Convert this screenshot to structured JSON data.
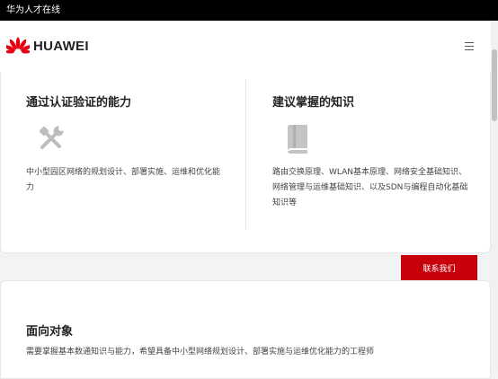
{
  "window": {
    "title": "华为人才在线"
  },
  "header": {
    "logo_text": "HUAWEI",
    "menu_icon": "hamburger-menu-icon",
    "brand_color": "#c7000b"
  },
  "capability": {
    "title": "通过认证验证的能力",
    "icon": "tools-icon",
    "description": "中小型园区网络的规划设计、部署实施、运维和优化能力"
  },
  "knowledge": {
    "title": "建议掌握的知识",
    "icon": "book-icon",
    "description": "路由交换原理、WLAN基本原理、网络安全基础知识、网络管理与运维基础知识、以及SDN与编程自动化基础知识等"
  },
  "contact_button": {
    "label": "联系我们",
    "color": "#c7000b"
  },
  "audience": {
    "title": "面向对象",
    "description": "需要掌握基本数通知识与能力，希望具备中小型网络规划设计、部署实施与运维优化能力的工程师"
  }
}
